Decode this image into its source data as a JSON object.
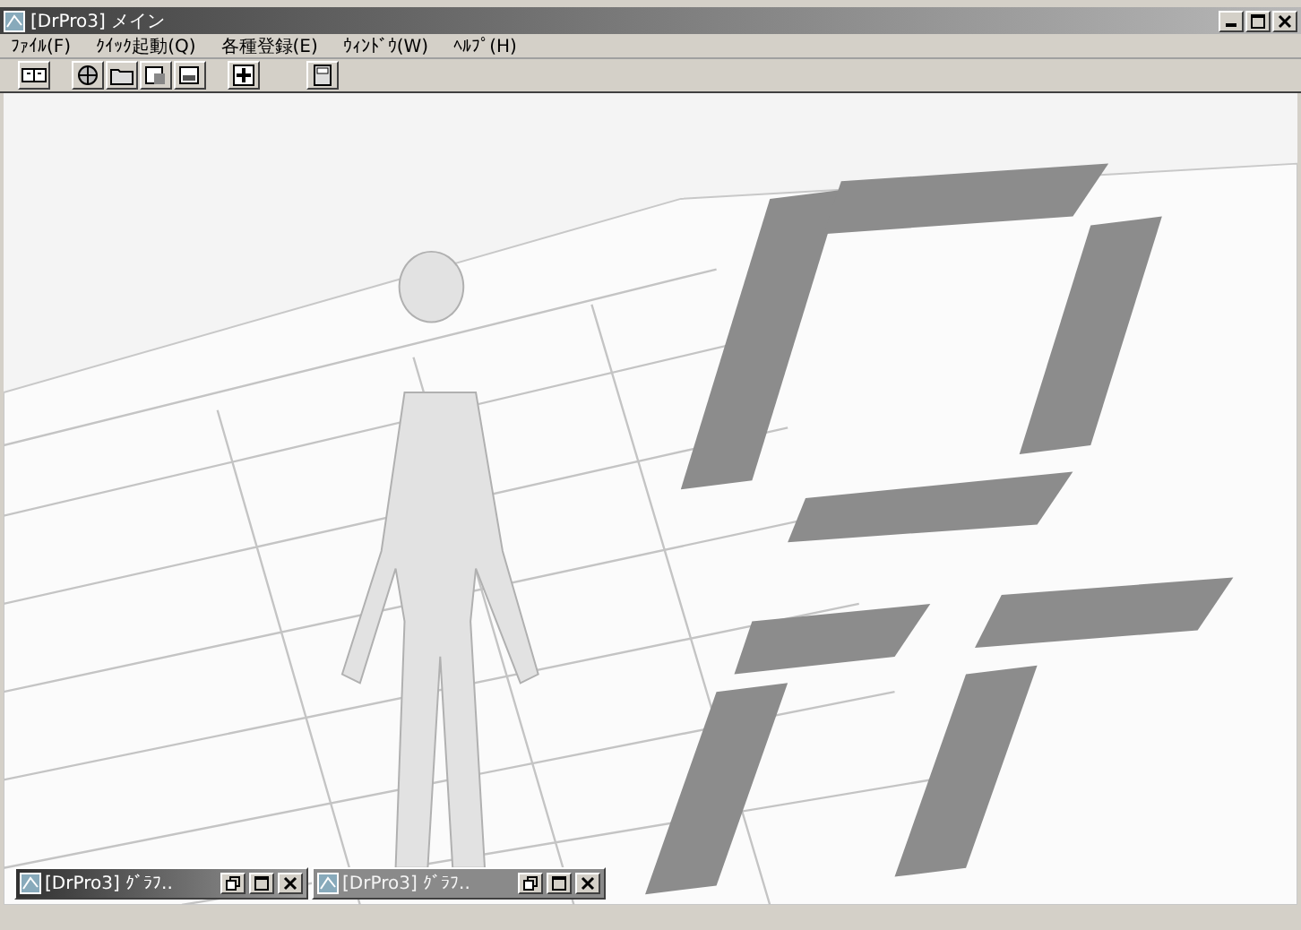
{
  "window": {
    "title": "[DrPro3] メイン"
  },
  "menu": [
    {
      "label": "ﾌｧｲﾙ(F)"
    },
    {
      "label": "ｸｲｯｸ起動(Q)"
    },
    {
      "label": "各種登録(E)"
    },
    {
      "label": "ｳｨﾝﾄﾞｳ(W)"
    },
    {
      "label": "ﾍﾙﾌﾟ(H)"
    }
  ],
  "minimized_windows": [
    {
      "title": "[DrPro3] ｸﾞﾗﾌ..",
      "active": true
    },
    {
      "title": "[DrPro3] ｸﾞﾗﾌ..",
      "active": false
    }
  ]
}
